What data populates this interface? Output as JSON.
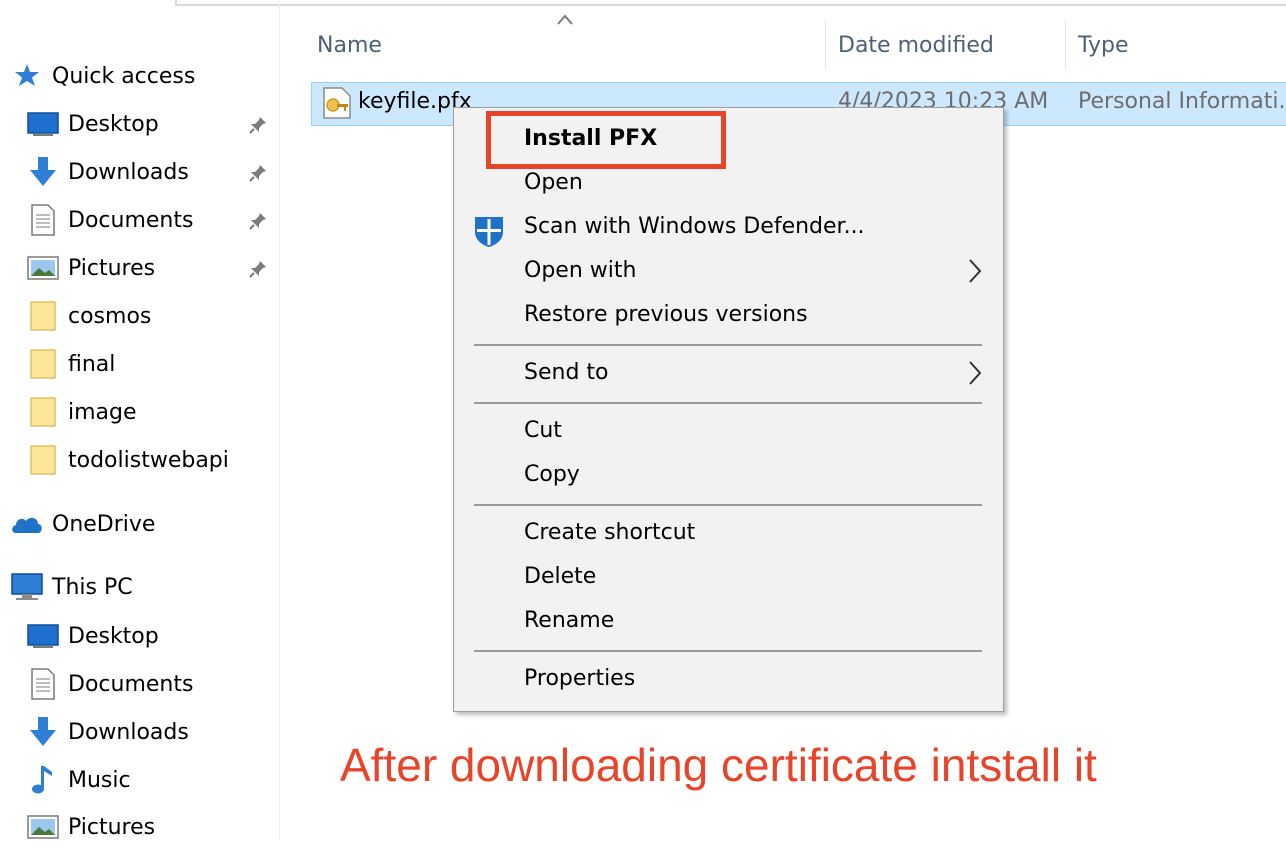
{
  "sidebar": {
    "quick_access": {
      "label": "Quick access",
      "icon": "star-icon"
    },
    "pinned": [
      {
        "label": "Desktop",
        "icon": "desktop-icon"
      },
      {
        "label": "Downloads",
        "icon": "download-icon"
      },
      {
        "label": "Documents",
        "icon": "document-icon"
      },
      {
        "label": "Pictures",
        "icon": "pictures-icon"
      }
    ],
    "folders": [
      {
        "label": "cosmos"
      },
      {
        "label": "final"
      },
      {
        "label": "image"
      },
      {
        "label": "todolistwebapi"
      }
    ],
    "onedrive": {
      "label": "OneDrive",
      "icon": "cloud-icon"
    },
    "this_pc": {
      "label": "This PC",
      "icon": "computer-icon",
      "items": [
        {
          "label": "Desktop",
          "icon": "desktop-icon"
        },
        {
          "label": "Documents",
          "icon": "document-icon"
        },
        {
          "label": "Downloads",
          "icon": "download-icon"
        },
        {
          "label": "Music",
          "icon": "music-icon"
        },
        {
          "label": "Pictures",
          "icon": "pictures-icon"
        }
      ]
    }
  },
  "columns": {
    "name": "Name",
    "date_modified": "Date modified",
    "type": "Type"
  },
  "file": {
    "name": "keyfile.pfx",
    "date": "4/4/2023 10:23 AM",
    "type": "Personal Informati..."
  },
  "context_menu": {
    "install": "Install PFX",
    "open": "Open",
    "scan": "Scan with Windows Defender...",
    "open_with": "Open with",
    "restore": "Restore previous versions",
    "send_to": "Send to",
    "cut": "Cut",
    "copy": "Copy",
    "create_shortcut": "Create shortcut",
    "delete": "Delete",
    "rename": "Rename",
    "properties": "Properties"
  },
  "caption": "After downloading certificate intstall it",
  "colors": {
    "accent": "#e8442a",
    "selection": "#cce8ff",
    "menu_bg": "#f2f2f2"
  }
}
